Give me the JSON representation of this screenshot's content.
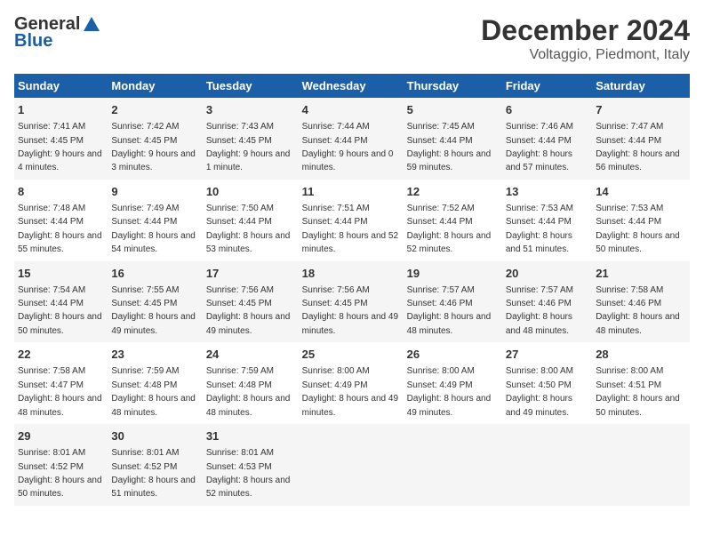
{
  "header": {
    "logo_general": "General",
    "logo_blue": "Blue",
    "main_title": "December 2024",
    "subtitle": "Voltaggio, Piedmont, Italy"
  },
  "columns": [
    "Sunday",
    "Monday",
    "Tuesday",
    "Wednesday",
    "Thursday",
    "Friday",
    "Saturday"
  ],
  "weeks": [
    [
      {
        "day": "1",
        "sunrise": "Sunrise: 7:41 AM",
        "sunset": "Sunset: 4:45 PM",
        "daylight": "Daylight: 9 hours and 4 minutes."
      },
      {
        "day": "2",
        "sunrise": "Sunrise: 7:42 AM",
        "sunset": "Sunset: 4:45 PM",
        "daylight": "Daylight: 9 hours and 3 minutes."
      },
      {
        "day": "3",
        "sunrise": "Sunrise: 7:43 AM",
        "sunset": "Sunset: 4:45 PM",
        "daylight": "Daylight: 9 hours and 1 minute."
      },
      {
        "day": "4",
        "sunrise": "Sunrise: 7:44 AM",
        "sunset": "Sunset: 4:44 PM",
        "daylight": "Daylight: 9 hours and 0 minutes."
      },
      {
        "day": "5",
        "sunrise": "Sunrise: 7:45 AM",
        "sunset": "Sunset: 4:44 PM",
        "daylight": "Daylight: 8 hours and 59 minutes."
      },
      {
        "day": "6",
        "sunrise": "Sunrise: 7:46 AM",
        "sunset": "Sunset: 4:44 PM",
        "daylight": "Daylight: 8 hours and 57 minutes."
      },
      {
        "day": "7",
        "sunrise": "Sunrise: 7:47 AM",
        "sunset": "Sunset: 4:44 PM",
        "daylight": "Daylight: 8 hours and 56 minutes."
      }
    ],
    [
      {
        "day": "8",
        "sunrise": "Sunrise: 7:48 AM",
        "sunset": "Sunset: 4:44 PM",
        "daylight": "Daylight: 8 hours and 55 minutes."
      },
      {
        "day": "9",
        "sunrise": "Sunrise: 7:49 AM",
        "sunset": "Sunset: 4:44 PM",
        "daylight": "Daylight: 8 hours and 54 minutes."
      },
      {
        "day": "10",
        "sunrise": "Sunrise: 7:50 AM",
        "sunset": "Sunset: 4:44 PM",
        "daylight": "Daylight: 8 hours and 53 minutes."
      },
      {
        "day": "11",
        "sunrise": "Sunrise: 7:51 AM",
        "sunset": "Sunset: 4:44 PM",
        "daylight": "Daylight: 8 hours and 52 minutes."
      },
      {
        "day": "12",
        "sunrise": "Sunrise: 7:52 AM",
        "sunset": "Sunset: 4:44 PM",
        "daylight": "Daylight: 8 hours and 52 minutes."
      },
      {
        "day": "13",
        "sunrise": "Sunrise: 7:53 AM",
        "sunset": "Sunset: 4:44 PM",
        "daylight": "Daylight: 8 hours and 51 minutes."
      },
      {
        "day": "14",
        "sunrise": "Sunrise: 7:53 AM",
        "sunset": "Sunset: 4:44 PM",
        "daylight": "Daylight: 8 hours and 50 minutes."
      }
    ],
    [
      {
        "day": "15",
        "sunrise": "Sunrise: 7:54 AM",
        "sunset": "Sunset: 4:44 PM",
        "daylight": "Daylight: 8 hours and 50 minutes."
      },
      {
        "day": "16",
        "sunrise": "Sunrise: 7:55 AM",
        "sunset": "Sunset: 4:45 PM",
        "daylight": "Daylight: 8 hours and 49 minutes."
      },
      {
        "day": "17",
        "sunrise": "Sunrise: 7:56 AM",
        "sunset": "Sunset: 4:45 PM",
        "daylight": "Daylight: 8 hours and 49 minutes."
      },
      {
        "day": "18",
        "sunrise": "Sunrise: 7:56 AM",
        "sunset": "Sunset: 4:45 PM",
        "daylight": "Daylight: 8 hours and 49 minutes."
      },
      {
        "day": "19",
        "sunrise": "Sunrise: 7:57 AM",
        "sunset": "Sunset: 4:46 PM",
        "daylight": "Daylight: 8 hours and 48 minutes."
      },
      {
        "day": "20",
        "sunrise": "Sunrise: 7:57 AM",
        "sunset": "Sunset: 4:46 PM",
        "daylight": "Daylight: 8 hours and 48 minutes."
      },
      {
        "day": "21",
        "sunrise": "Sunrise: 7:58 AM",
        "sunset": "Sunset: 4:46 PM",
        "daylight": "Daylight: 8 hours and 48 minutes."
      }
    ],
    [
      {
        "day": "22",
        "sunrise": "Sunrise: 7:58 AM",
        "sunset": "Sunset: 4:47 PM",
        "daylight": "Daylight: 8 hours and 48 minutes."
      },
      {
        "day": "23",
        "sunrise": "Sunrise: 7:59 AM",
        "sunset": "Sunset: 4:48 PM",
        "daylight": "Daylight: 8 hours and 48 minutes."
      },
      {
        "day": "24",
        "sunrise": "Sunrise: 7:59 AM",
        "sunset": "Sunset: 4:48 PM",
        "daylight": "Daylight: 8 hours and 48 minutes."
      },
      {
        "day": "25",
        "sunrise": "Sunrise: 8:00 AM",
        "sunset": "Sunset: 4:49 PM",
        "daylight": "Daylight: 8 hours and 49 minutes."
      },
      {
        "day": "26",
        "sunrise": "Sunrise: 8:00 AM",
        "sunset": "Sunset: 4:49 PM",
        "daylight": "Daylight: 8 hours and 49 minutes."
      },
      {
        "day": "27",
        "sunrise": "Sunrise: 8:00 AM",
        "sunset": "Sunset: 4:50 PM",
        "daylight": "Daylight: 8 hours and 49 minutes."
      },
      {
        "day": "28",
        "sunrise": "Sunrise: 8:00 AM",
        "sunset": "Sunset: 4:51 PM",
        "daylight": "Daylight: 8 hours and 50 minutes."
      }
    ],
    [
      {
        "day": "29",
        "sunrise": "Sunrise: 8:01 AM",
        "sunset": "Sunset: 4:52 PM",
        "daylight": "Daylight: 8 hours and 50 minutes."
      },
      {
        "day": "30",
        "sunrise": "Sunrise: 8:01 AM",
        "sunset": "Sunset: 4:52 PM",
        "daylight": "Daylight: 8 hours and 51 minutes."
      },
      {
        "day": "31",
        "sunrise": "Sunrise: 8:01 AM",
        "sunset": "Sunset: 4:53 PM",
        "daylight": "Daylight: 8 hours and 52 minutes."
      },
      {
        "day": "",
        "sunrise": "",
        "sunset": "",
        "daylight": ""
      },
      {
        "day": "",
        "sunrise": "",
        "sunset": "",
        "daylight": ""
      },
      {
        "day": "",
        "sunrise": "",
        "sunset": "",
        "daylight": ""
      },
      {
        "day": "",
        "sunrise": "",
        "sunset": "",
        "daylight": ""
      }
    ]
  ]
}
